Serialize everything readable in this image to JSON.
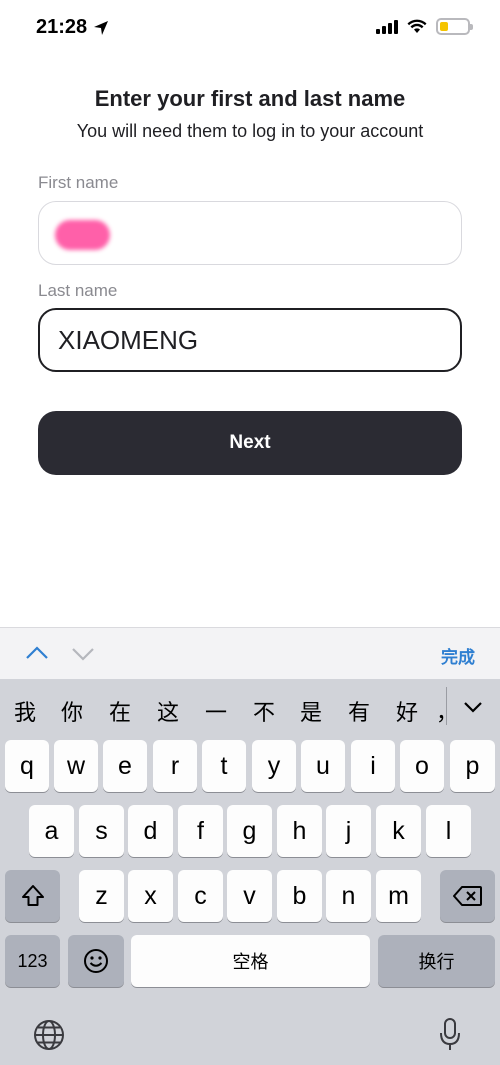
{
  "status": {
    "time": "21:28"
  },
  "form": {
    "title": "Enter your first and last name",
    "subtitle": "You will need them to log in to your account",
    "first_name_label": "First name",
    "first_name_value": "",
    "last_name_label": "Last name",
    "last_name_value": "XIAOMENG",
    "next_label": "Next"
  },
  "toolbar": {
    "done_label": "完成"
  },
  "keyboard": {
    "candidates": [
      "我",
      "你",
      "在",
      "这",
      "一",
      "不",
      "是",
      "有",
      "好",
      "，"
    ],
    "row1": [
      "q",
      "w",
      "e",
      "r",
      "t",
      "y",
      "u",
      "i",
      "o",
      "p"
    ],
    "row2": [
      "a",
      "s",
      "d",
      "f",
      "g",
      "h",
      "j",
      "k",
      "l"
    ],
    "row3": [
      "z",
      "x",
      "c",
      "v",
      "b",
      "n",
      "m"
    ],
    "numbers_label": "123",
    "space_label": "空格",
    "return_label": "换行"
  },
  "colors": {
    "accent": "#2f7fd1",
    "button": "#2b2b33",
    "battery": "#f5c400"
  }
}
